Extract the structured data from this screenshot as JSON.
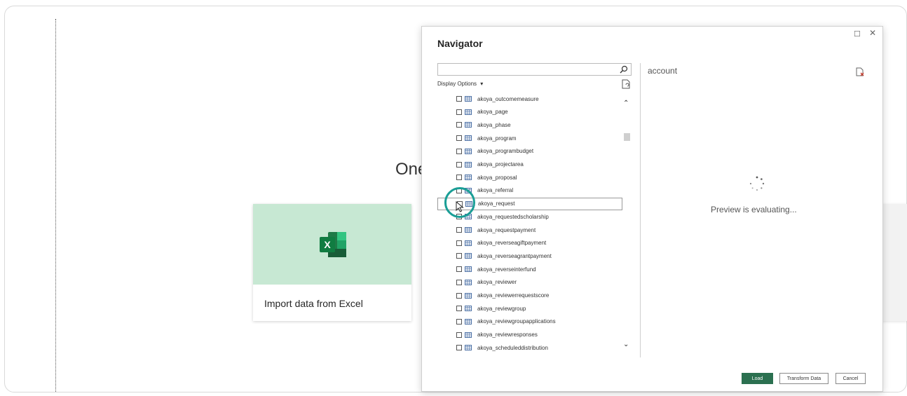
{
  "background": {
    "partial_title": "One",
    "excel_card": {
      "label": "Import data from Excel",
      "logo_letter": "X",
      "accent": "#c7e8d3"
    }
  },
  "navigator": {
    "title": "Navigator",
    "window_controls": {
      "maximize": "☐",
      "close": "✕"
    },
    "search": {
      "value": "",
      "placeholder": ""
    },
    "display_options_label": "Display Options",
    "display_options_caret": "▾",
    "tables": [
      "akoya_outcomemeasure",
      "akoya_page",
      "akoya_phase",
      "akoya_program",
      "akoya_programbudget",
      "akoya_projectarea",
      "akoya_proposal",
      "akoya_referral",
      "akoya_request",
      "akoya_requestedscholarship",
      "akoya_requestpayment",
      "akoya_reverseagiftpayment",
      "akoya_reverseagrantpayment",
      "akoya_reverseinterfund",
      "akoya_reviewer",
      "akoya_reviewerrequestscore",
      "akoya_reviewgroup",
      "akoya_reviewgroupapplications",
      "akoya_reviewresponses",
      "akoya_scheduleddistribution"
    ],
    "selected_index": 8,
    "preview": {
      "title": "account",
      "message": "Preview is evaluating..."
    },
    "buttons": {
      "load": "Load",
      "transform": "Transform Data",
      "cancel": "Cancel"
    },
    "colors": {
      "load_button": "#2b7050",
      "cursor_ring": "#1a9e96"
    }
  }
}
